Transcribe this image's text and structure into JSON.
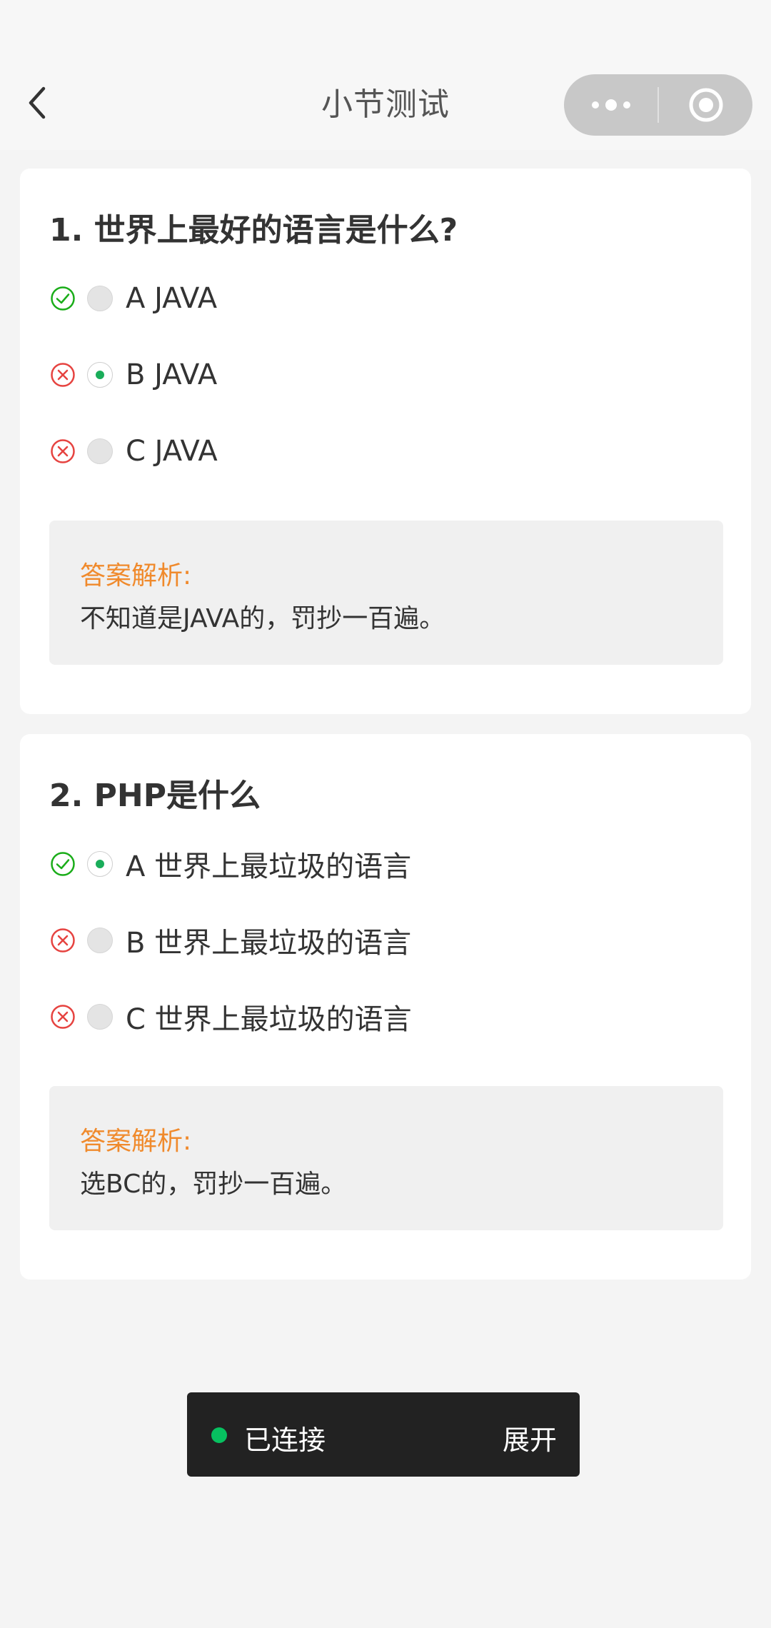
{
  "header": {
    "title": "小节测试",
    "back_icon": "chevron-left-icon",
    "more_icon": "more-dots-icon",
    "close_icon": "target-close-icon"
  },
  "questions": [
    {
      "title": "1. 世界上最好的语言是什么?",
      "options": [
        {
          "label": "A JAVA",
          "status": "correct",
          "selected": false
        },
        {
          "label": "B JAVA",
          "status": "wrong",
          "selected": true
        },
        {
          "label": "C JAVA",
          "status": "wrong",
          "selected": false
        }
      ],
      "analysis_label": "答案解析:",
      "analysis_text": "不知道是JAVA的，罚抄一百遍。"
    },
    {
      "title": "2. PHP是什么",
      "options": [
        {
          "label": "A 世界上最垃圾的语言",
          "status": "correct",
          "selected": true
        },
        {
          "label": "B 世界上最垃圾的语言",
          "status": "wrong",
          "selected": false
        },
        {
          "label": "C 世界上最垃圾的语言",
          "status": "wrong",
          "selected": false
        }
      ],
      "analysis_label": "答案解析:",
      "analysis_text": "选BC的，罚抄一百遍。"
    }
  ],
  "connection": {
    "status": "已连接",
    "expand_label": "展开"
  },
  "colors": {
    "correct": "#1aad19",
    "wrong": "#e64340",
    "analysis_label": "#f08a2c",
    "connected_dot": "#07c160"
  }
}
